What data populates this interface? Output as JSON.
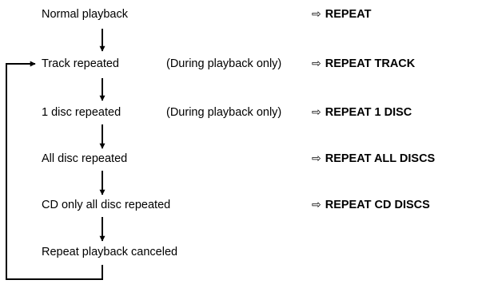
{
  "arrow_symbol": "⇨",
  "steps": [
    {
      "label": "Normal playback",
      "note": "",
      "display": "REPEAT"
    },
    {
      "label": "Track repeated",
      "note": "(During playback only)",
      "display": "REPEAT TRACK"
    },
    {
      "label": "1 disc repeated",
      "note": "(During playback only)",
      "display": "REPEAT 1 DISC"
    },
    {
      "label": "All disc repeated",
      "note": "",
      "display": "REPEAT ALL DISCS"
    },
    {
      "label": "CD only all disc repeated",
      "note": "",
      "display": "REPEAT CD DISCS"
    },
    {
      "label": "Repeat playback canceled",
      "note": "",
      "display": ""
    }
  ]
}
